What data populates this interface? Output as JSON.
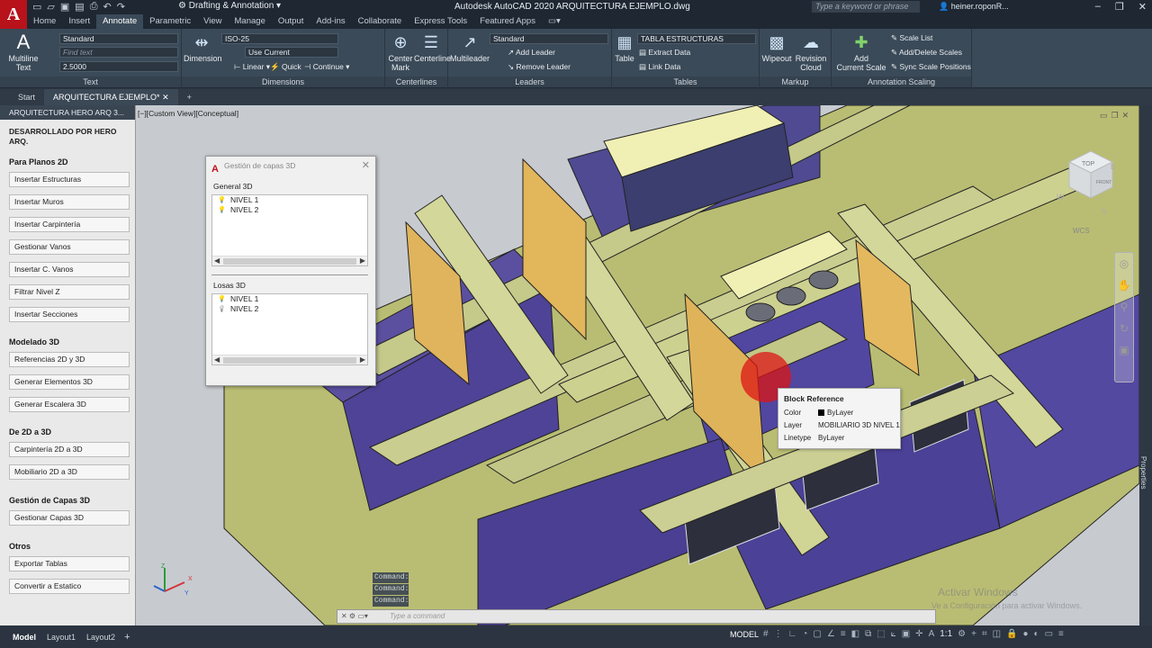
{
  "app": {
    "logo_letter": "A",
    "workspace": "Drafting & Annotation",
    "window_title": "Autodesk AutoCAD 2020   ARQUITECTURA EJEMPLO.dwg",
    "search_placeholder": "Type a keyword or phrase",
    "user": "heiner.roponR..."
  },
  "ribbon_tabs": [
    "Home",
    "Insert",
    "Annotate",
    "Parametric",
    "View",
    "Manage",
    "Output",
    "Add-ins",
    "Collaborate",
    "Express Tools",
    "Featured Apps"
  ],
  "ribbon": {
    "text": {
      "title": "Text",
      "multiline": "Multiline\nText",
      "style": "Standard",
      "find": "Find text",
      "height": "2.5000"
    },
    "dimensions": {
      "title": "Dimensions",
      "dimension": "Dimension",
      "style": "ISO-25",
      "layer": "Use Current",
      "linear": "Linear",
      "quick": "Quick",
      "continue": "Continue"
    },
    "centerlines": {
      "title": "Centerlines",
      "center_mark": "Center\nMark",
      "centerline": "Centerline"
    },
    "leaders": {
      "title": "Leaders",
      "multileader": "Multileader",
      "style": "Standard",
      "add": "Add Leader",
      "remove": "Remove Leader"
    },
    "tables": {
      "title": "Tables",
      "table": "Table",
      "style": "TABLA ESTRUCTURAS",
      "extract": "Extract Data",
      "link": "Link Data"
    },
    "markup": {
      "title": "Markup",
      "wipeout": "Wipeout",
      "revision": "Revision\nCloud"
    },
    "scaling": {
      "title": "Annotation Scaling",
      "add_scale": "Add\nCurrent Scale",
      "scale_list": "Scale List",
      "add_delete": "Add/Delete Scales",
      "sync": "Sync Scale Positions"
    }
  },
  "doc_tabs": [
    "Start",
    "ARQUITECTURA EJEMPLO*"
  ],
  "palette": {
    "header": "ARQUITECTURA HERO ARQ 3...",
    "developer": "DESARROLLADO POR HERO ARQ.",
    "sections": [
      {
        "title": "Para Planos 2D",
        "buttons": [
          "Insertar Estructuras",
          "Insertar Muros",
          "Insertar Carpintería",
          "Gestionar Vanos",
          "Insertar C. Vanos",
          "Filtrar Nivel Z",
          "Insertar Secciones"
        ]
      },
      {
        "title": "Modelado 3D",
        "buttons": [
          "Referencias 2D y 3D",
          "Generar Elementos 3D",
          "Generar Escalera 3D"
        ]
      },
      {
        "title": "De 2D a 3D",
        "buttons": [
          "Carpintería 2D a 3D",
          "Mobiliario 2D a 3D"
        ]
      },
      {
        "title": "Gestión de Capas 3D",
        "buttons": [
          "Gestionar Capas 3D"
        ]
      },
      {
        "title": "Otros",
        "buttons": [
          "Exportar Tablas",
          "Convertir a Estatico"
        ]
      }
    ]
  },
  "viewport": {
    "label": "[−][Custom View][Conceptual]",
    "wcs": "WCS",
    "cube_top": "TOP",
    "cube_front": "FRONT"
  },
  "layer_dialog": {
    "title": "Gestión de capas 3D",
    "groups": [
      {
        "title": "General 3D",
        "items": [
          "NIVEL 1",
          "NIVEL 2"
        ]
      },
      {
        "title": "Losas 3D",
        "items": [
          "NIVEL 1",
          "NIVEL 2"
        ]
      }
    ]
  },
  "tooltip": {
    "title": "Block Reference",
    "rows": [
      {
        "k": "Color",
        "v": "ByLayer"
      },
      {
        "k": "Layer",
        "v": "MOBILIARIO 3D NIVEL 1"
      },
      {
        "k": "Linetype",
        "v": "ByLayer"
      }
    ]
  },
  "command": {
    "history": [
      "Command:",
      "Command:",
      "Command:"
    ],
    "placeholder": "Type a command"
  },
  "status": {
    "layouts": [
      "Model",
      "Layout1",
      "Layout2"
    ],
    "model": "MODEL",
    "scale": "1:1"
  },
  "side": {
    "properties": "Properties"
  },
  "watermark": {
    "line1": "Activar Windows",
    "line2": "Ve a Configuración para activar Windows."
  }
}
